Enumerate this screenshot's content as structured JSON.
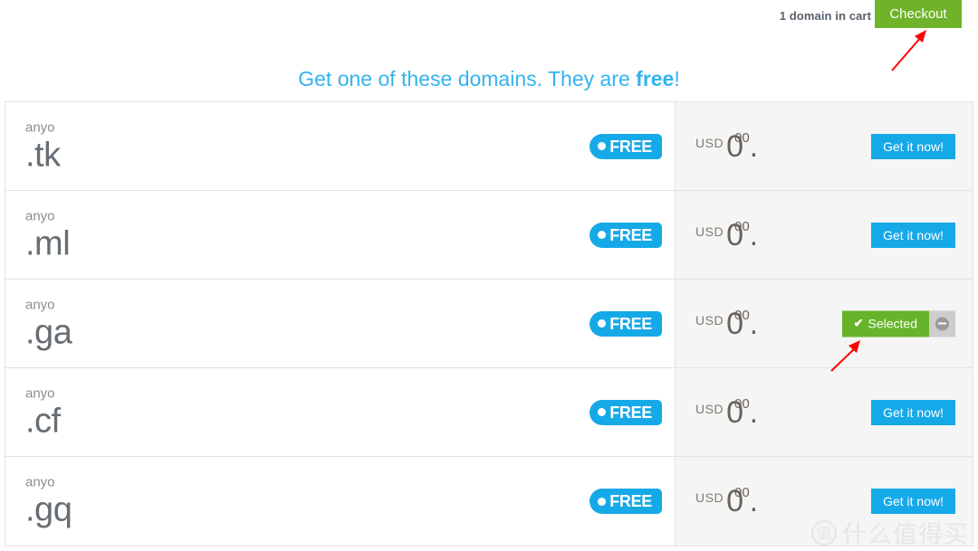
{
  "topbar": {
    "cart_status": "1 domain in cart",
    "checkout_label": "Checkout"
  },
  "headline": {
    "prefix": "Get one of these domains. They are ",
    "emphasis": "free",
    "suffix": "!"
  },
  "labels": {
    "free_badge": "FREE",
    "currency": "USD",
    "amount": "0",
    "decimal_separator": ".",
    "cents": "00",
    "get_it_now": "Get it now!",
    "selected": "Selected",
    "check_glyph": "✔"
  },
  "colors": {
    "accent_blue": "#16a9e8",
    "headline_blue": "#34b3ef",
    "green": "#6fb32a",
    "selected_green": "#65b42a",
    "panel_gray": "#f5f5f5",
    "border_gray": "#e2e2e2",
    "annotation_red": "#ff0000"
  },
  "rows": [
    {
      "domain_name": "anyo",
      "tld": ".tk",
      "badge": "FREE",
      "currency": "USD",
      "amount": "0",
      "cents": "00",
      "action": "get",
      "action_label": "Get it now!"
    },
    {
      "domain_name": "anyo",
      "tld": ".ml",
      "badge": "FREE",
      "currency": "USD",
      "amount": "0",
      "cents": "00",
      "action": "get",
      "action_label": "Get it now!"
    },
    {
      "domain_name": "anyo",
      "tld": ".ga",
      "badge": "FREE",
      "currency": "USD",
      "amount": "0",
      "cents": "00",
      "action": "selected",
      "action_label": "Selected"
    },
    {
      "domain_name": "anyo",
      "tld": ".cf",
      "badge": "FREE",
      "currency": "USD",
      "amount": "0",
      "cents": "00",
      "action": "get",
      "action_label": "Get it now!"
    },
    {
      "domain_name": "anyo",
      "tld": ".gq",
      "badge": "FREE",
      "currency": "USD",
      "amount": "0",
      "cents": "00",
      "action": "get",
      "action_label": "Get it now!"
    }
  ],
  "annotations": [
    {
      "name": "arrow-to-checkout",
      "points_to": "Checkout"
    },
    {
      "name": "arrow-to-selected",
      "points_to": "Selected"
    }
  ],
  "watermark": {
    "logo_char": "值",
    "text": "什么值得买"
  }
}
